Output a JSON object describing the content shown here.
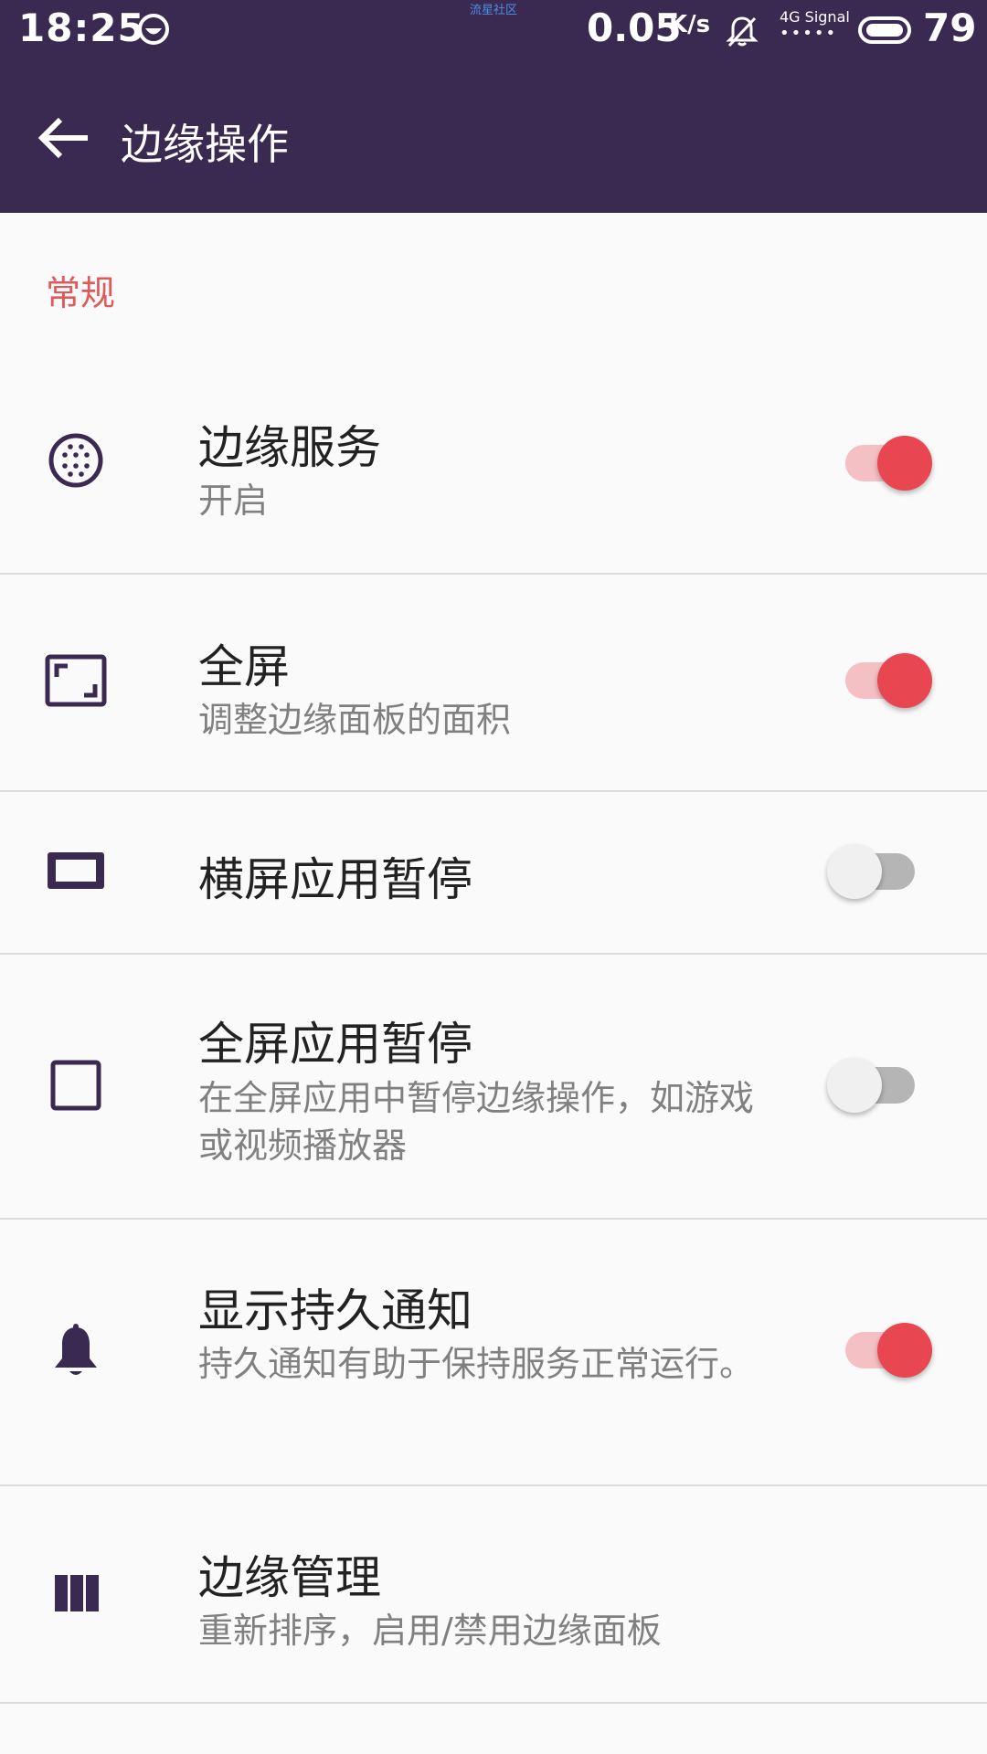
{
  "status_bar": {
    "time": "18:25",
    "watermark": "流星社区",
    "net_speed": "0.05",
    "net_speed_unit": "K/s",
    "signal_label_top": "4G Signal",
    "signal_dots": "•••••",
    "battery": "79"
  },
  "toolbar": {
    "back_icon": "arrow-left-icon",
    "title": "边缘操作"
  },
  "section": {
    "title": "常规"
  },
  "rows": [
    {
      "icon": "dotted-circle-icon",
      "title": "边缘服务",
      "subtitle": "开启",
      "switch_on": true
    },
    {
      "icon": "fullscreen-icon",
      "title": "全屏",
      "subtitle": "调整边缘面板的面积",
      "switch_on": true
    },
    {
      "icon": "landscape-icon",
      "title": "横屏应用暂停",
      "subtitle": "",
      "switch_on": false
    },
    {
      "icon": "square-icon",
      "title": "全屏应用暂停",
      "subtitle": "在全屏应用中暂停边缘操作，如游戏或视频播放器",
      "switch_on": false
    },
    {
      "icon": "bell-icon",
      "title": "显示持久通知",
      "subtitle": "持久通知有助于保持服务正常运行。",
      "switch_on": true
    },
    {
      "icon": "columns-icon",
      "title": "边缘管理",
      "subtitle": "重新排序，启用/禁用边缘面板"
    }
  ],
  "colors": {
    "appbar": "#3a2a52",
    "accent": "#e84650",
    "section_header": "#e05a5a",
    "icon": "#3a2a52"
  }
}
